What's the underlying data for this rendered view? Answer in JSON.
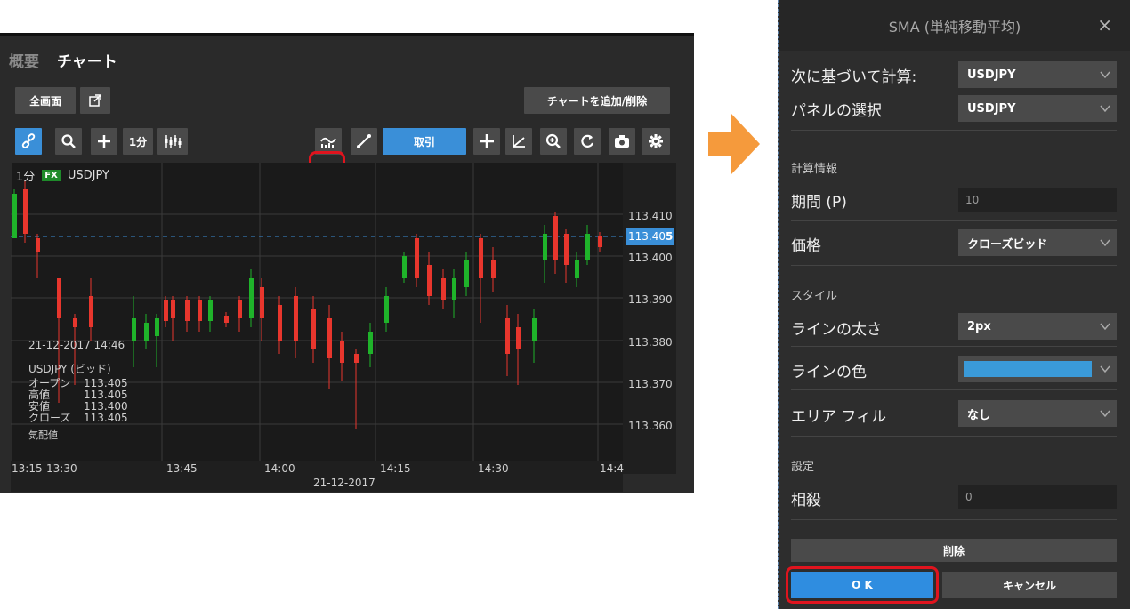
{
  "left_panel": {
    "tabs": [
      "概要",
      "チャート"
    ],
    "fullscreen_label": "全画面",
    "add_remove_label": "チャートを追加/削除",
    "interval_label": "1分",
    "trade_label": "取引",
    "symbol": "USDJPY",
    "fx_badge": "FX",
    "interval_overlay": "1分",
    "current_price_main": "113.40",
    "current_price_accent": "5",
    "price_ticks": [
      "113.410",
      "113.400",
      "113.390",
      "113.380",
      "113.370",
      "113.360"
    ],
    "time_ticks": [
      "13:15",
      "13:30",
      "13:45",
      "14:00",
      "14:15",
      "14:30",
      "14:4"
    ],
    "date_label": "21-12-2017",
    "ohlc": {
      "timestamp": "21-12-2017 14:46",
      "title": "USDJPY (ビッド)",
      "rows": [
        {
          "k": "オープン",
          "v": "113.405"
        },
        {
          "k": "高値",
          "v": "113.405"
        },
        {
          "k": "安値",
          "v": "113.400"
        },
        {
          "k": "クローズ",
          "v": "113.405"
        }
      ],
      "footer": "気配値"
    },
    "colors": {
      "up": "#1fb32a",
      "down": "#e8362d",
      "accent": "#3a8fd8"
    }
  },
  "dialog": {
    "title": "SMA (単純移動平均)",
    "close": "×",
    "calc_basis_label": "次に基づいて計算:",
    "calc_basis_value": "USDJPY",
    "panel_label": "パネルの選択",
    "panel_value": "USDJPY",
    "section_calc": "計算情報",
    "period_label": "期間 (P)",
    "period_value": "10",
    "price_label": "価格",
    "price_value": "クローズビッド",
    "section_style": "スタイル",
    "line_width_label": "ラインの太さ",
    "line_width_value": "2px",
    "line_color_label": "ラインの色",
    "line_color_value": "#3a9ad9",
    "area_fill_label": "エリア フィル",
    "area_fill_value": "なし",
    "section_settings": "設定",
    "offset_label": "相殺",
    "offset_value": "0",
    "delete_label": "削除",
    "ok_label": "O K",
    "cancel_label": "キャンセル"
  }
}
